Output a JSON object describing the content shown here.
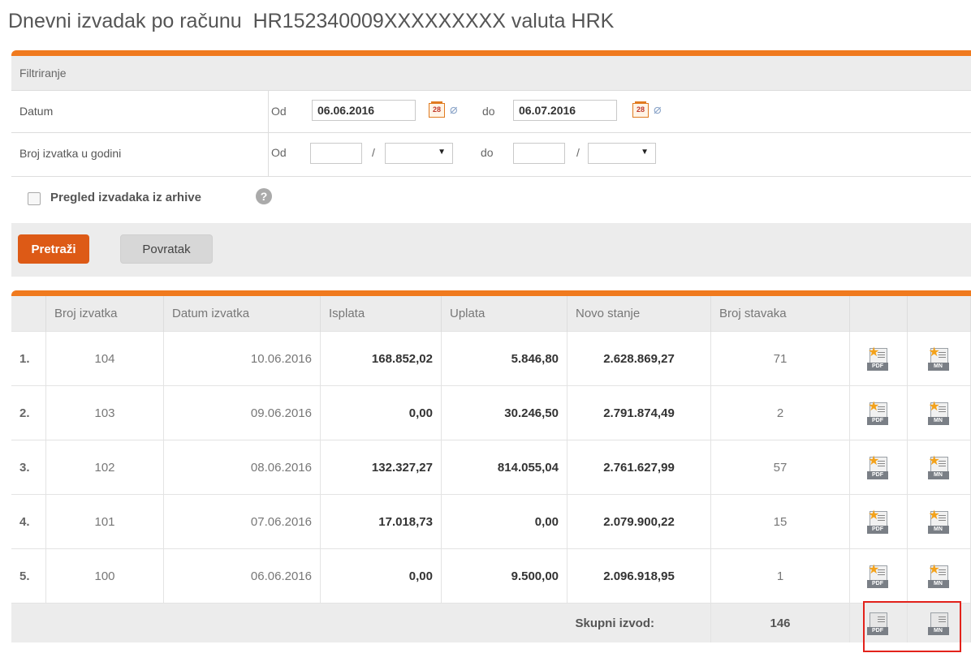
{
  "page": {
    "title_prefix": "Dnevni izvadak po računu",
    "account": "HR152340009XXXXXXXXX",
    "currency_label": "valuta HRK"
  },
  "filter": {
    "header": "Filtriranje",
    "date_label": "Datum",
    "from_label": "Od",
    "to_label": "do",
    "date_from": "06.06.2016",
    "date_to": "06.07.2016",
    "stmt_label": "Broj izvatka u godini",
    "slash": "/",
    "archive_label": "Pregled izvadaka iz arhive",
    "help_glyph": "?",
    "calendar_day": "28",
    "search_button": "Pretraži",
    "back_button": "Povratak"
  },
  "table": {
    "columns": [
      "Broj izvatka",
      "Datum izvatka",
      "Isplata",
      "Uplata",
      "Novo stanje",
      "Broj stavaka"
    ],
    "rows": [
      {
        "idx": "1.",
        "no": "104",
        "date": "10.06.2016",
        "out": "168.852,02",
        "in": "5.846,80",
        "balance": "2.628.869,27",
        "items": "71"
      },
      {
        "idx": "2.",
        "no": "103",
        "date": "09.06.2016",
        "out": "0,00",
        "in": "30.246,50",
        "balance": "2.791.874,49",
        "items": "2"
      },
      {
        "idx": "3.",
        "no": "102",
        "date": "08.06.2016",
        "out": "132.327,27",
        "in": "814.055,04",
        "balance": "2.761.627,99",
        "items": "57"
      },
      {
        "idx": "4.",
        "no": "101",
        "date": "07.06.2016",
        "out": "17.018,73",
        "in": "0,00",
        "balance": "2.079.900,22",
        "items": "15"
      },
      {
        "idx": "5.",
        "no": "100",
        "date": "06.06.2016",
        "out": "0,00",
        "in": "9.500,00",
        "balance": "2.096.918,95",
        "items": "1"
      }
    ],
    "total_label": "Skupni izvod:",
    "total_items": "146",
    "pdf_tag": "PDF",
    "mn_tag": "MN"
  },
  "colors": {
    "accent": "#f07a1e",
    "button": "#dd5a16",
    "highlight": "#e3221b"
  }
}
